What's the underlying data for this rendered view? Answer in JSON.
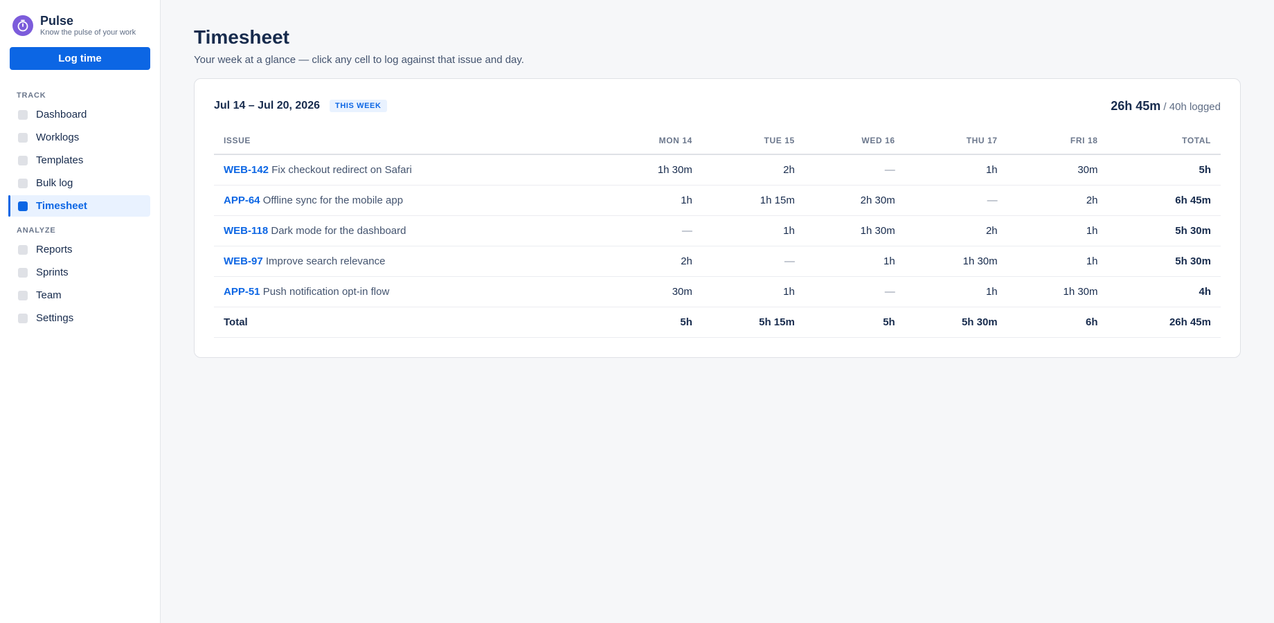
{
  "app": {
    "name": "Pulse",
    "tagline": "Know the pulse of your work"
  },
  "sidebar": {
    "log_button": "Log time",
    "sections": [
      {
        "title": "TRACK",
        "items": [
          "Dashboard",
          "Worklogs",
          "Templates",
          "Bulk log",
          "Timesheet"
        ]
      },
      {
        "title": "ANALYZE",
        "items": [
          "Reports",
          "Sprints",
          "Team",
          "Settings"
        ]
      }
    ],
    "active_item": "Timesheet"
  },
  "page": {
    "title": "Timesheet",
    "subtitle": "Your week at a glance — click any cell to log against that issue and day."
  },
  "card": {
    "range": "Jul 14 – Jul 20, 2026",
    "badge": "THIS WEEK",
    "logged_total": "26h 45m",
    "logged_target": "/ 40h logged"
  },
  "table": {
    "columns": [
      "ISSUE",
      "MON 14",
      "TUE 15",
      "WED 16",
      "THU 17",
      "FRI 18",
      "TOTAL"
    ],
    "rows": [
      {
        "key": "WEB-142",
        "title": "Fix checkout redirect on Safari",
        "cells": [
          "1h 30m",
          "2h",
          "—",
          "1h",
          "30m"
        ],
        "total": "5h"
      },
      {
        "key": "APP-64",
        "title": "Offline sync for the mobile app",
        "cells": [
          "1h",
          "1h 15m",
          "2h 30m",
          "—",
          "2h"
        ],
        "total": "6h 45m"
      },
      {
        "key": "WEB-118",
        "title": "Dark mode for the dashboard",
        "cells": [
          "—",
          "1h",
          "1h 30m",
          "2h",
          "1h"
        ],
        "total": "5h 30m"
      },
      {
        "key": "WEB-97",
        "title": "Improve search relevance",
        "cells": [
          "2h",
          "—",
          "1h",
          "1h 30m",
          "1h"
        ],
        "total": "5h 30m"
      },
      {
        "key": "APP-51",
        "title": "Push notification opt-in flow",
        "cells": [
          "30m",
          "1h",
          "—",
          "1h",
          "1h 30m"
        ],
        "total": "4h"
      }
    ],
    "totals": {
      "label": "Total",
      "cells": [
        "5h",
        "5h 15m",
        "5h",
        "5h 30m",
        "6h"
      ],
      "total": "26h 45m"
    }
  },
  "colors": {
    "accent": "#0c66e4",
    "brand": "#7c5cdb",
    "text": "#172b4d",
    "muted": "#5e6c84"
  }
}
